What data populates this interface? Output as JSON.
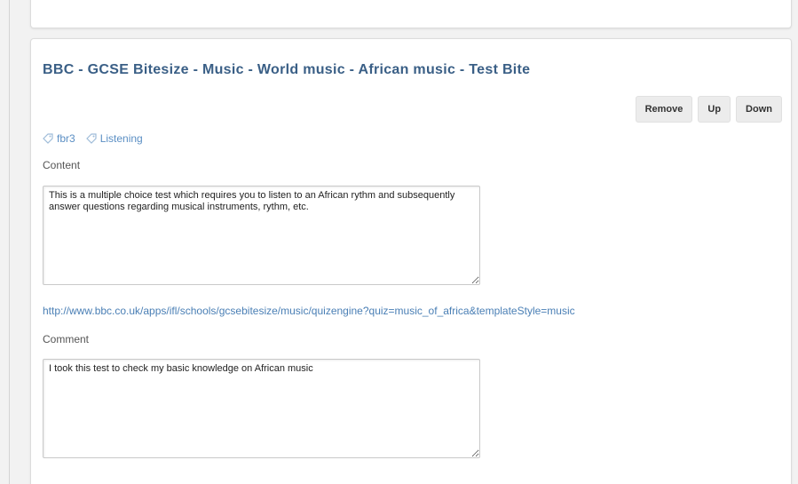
{
  "item": {
    "title": "BBC - GCSE Bitesize - Music - World music - African music - Test Bite",
    "actions": {
      "remove_label": "Remove",
      "up_label": "Up",
      "down_label": "Down"
    },
    "tags": [
      {
        "label": "fbr3",
        "icon": "tag-icon"
      },
      {
        "label": "Listening",
        "icon": "tag-icon"
      }
    ],
    "content": {
      "label": "Content",
      "value": "This is a multiple choice test which requires you to listen to an African rythm and subsequently answer questions regarding musical instruments, rythm, etc."
    },
    "link": "http://www.bbc.co.uk/apps/ifl/schools/gcsebitesize/music/quizengine?quiz=music_of_africa&templateStyle=music",
    "comment": {
      "label": "Comment",
      "value": "I took this test to check my basic knowledge on African music"
    }
  },
  "colors": {
    "title": "#3a5f86",
    "link": "#4a7fb5",
    "tag": "#5b8fc4",
    "button_bg": "#ececec"
  }
}
